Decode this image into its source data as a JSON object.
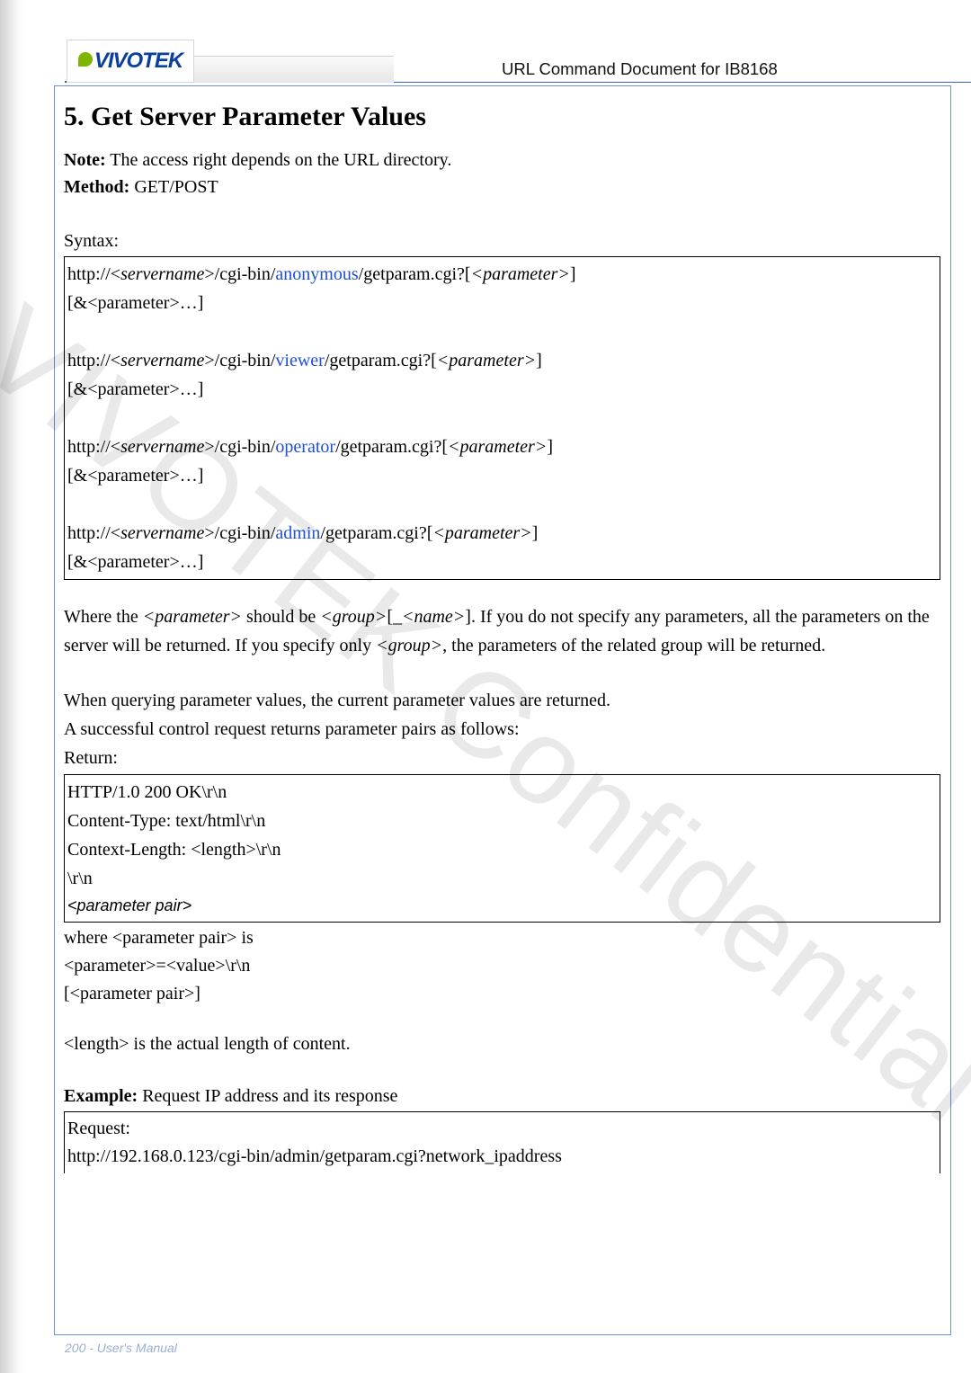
{
  "header": {
    "logo_text": "VIVOTEK",
    "doc_title": "URL Command Document for IB8168"
  },
  "watermark": "VIVOTEK Confidential",
  "section": {
    "title": "5. Get Server Parameter Values",
    "note_label": "Note:",
    "note_text": " The access right depends on the URL directory.",
    "method_label": "Method:",
    "method_text": " GET/POST",
    "syntax_label": "Syntax:",
    "syntax_lines": [
      {
        "segments": [
          "http://<",
          {
            "t": "servername",
            "cls": "ital"
          },
          ">/cgi-bin/",
          {
            "t": "anonymous",
            "cls": "blue"
          },
          "/getparam.cgi?[",
          {
            "t": "<parameter>",
            "cls": "ital"
          },
          "]"
        ]
      },
      {
        "segments": [
          "[&<parameter>…]"
        ]
      },
      {
        "blank": true
      },
      {
        "segments": [
          "http://<",
          {
            "t": "servername",
            "cls": "ital"
          },
          ">/cgi-bin/",
          {
            "t": "viewer",
            "cls": "blue"
          },
          "/getparam.cgi?[",
          {
            "t": "<parameter>",
            "cls": "ital"
          },
          "]"
        ]
      },
      {
        "segments": [
          "[&<parameter>…]"
        ]
      },
      {
        "blank": true
      },
      {
        "segments": [
          "http://<",
          {
            "t": "servername",
            "cls": "ital"
          },
          ">/cgi-bin/",
          {
            "t": "operator",
            "cls": "blue"
          },
          "/getparam.cgi?[",
          {
            "t": "<parameter>",
            "cls": "ital"
          },
          "]"
        ]
      },
      {
        "segments": [
          "[&<parameter>…]"
        ]
      },
      {
        "blank": true
      },
      {
        "segments": [
          "http://<",
          {
            "t": "servername",
            "cls": "ital"
          },
          ">/cgi-bin/",
          {
            "t": "admin",
            "cls": "blue"
          },
          "/getparam.cgi?[",
          {
            "t": "<parameter>",
            "cls": "ital"
          },
          "]"
        ]
      },
      {
        "segments": [
          "[&<parameter>…]"
        ]
      }
    ],
    "where_para_segments": [
      "Where the ",
      {
        "t": "<parameter>",
        "cls": "ital"
      },
      " should be ",
      {
        "t": "<group>",
        "cls": "ital"
      },
      "[_",
      {
        "t": "<name>",
        "cls": "ital"
      },
      "]. If you do not specify any parameters, all the parameters on the server will be returned. If you specify only ",
      {
        "t": "<group>",
        "cls": "ital"
      },
      ", the parameters of the related group will be returned."
    ],
    "query_para1": "When querying parameter values, the current parameter values are returned.",
    "query_para2": "A successful control request returns parameter pairs as follows:",
    "return_label": "Return:",
    "return_lines": [
      "HTTP/1.0 200 OK\\r\\n",
      "Content-Type: text/html\\r\\n",
      "Context-Length: <length>\\r\\n",
      "\\r\\n"
    ],
    "parameter_pair_line": "<parameter pair>",
    "where_pair_lines": [
      "where <parameter pair> is",
      "<parameter>=<value>\\r\\n",
      "[<parameter pair>]"
    ],
    "length_line": "<length> is the actual length of content.",
    "example_label": "Example:",
    "example_text": " Request IP address and its response",
    "example_lines": [
      "Request:",
      "http://192.168.0.123/cgi-bin/admin/getparam.cgi?network_ipaddress"
    ]
  },
  "footer": "200 - User's Manual"
}
